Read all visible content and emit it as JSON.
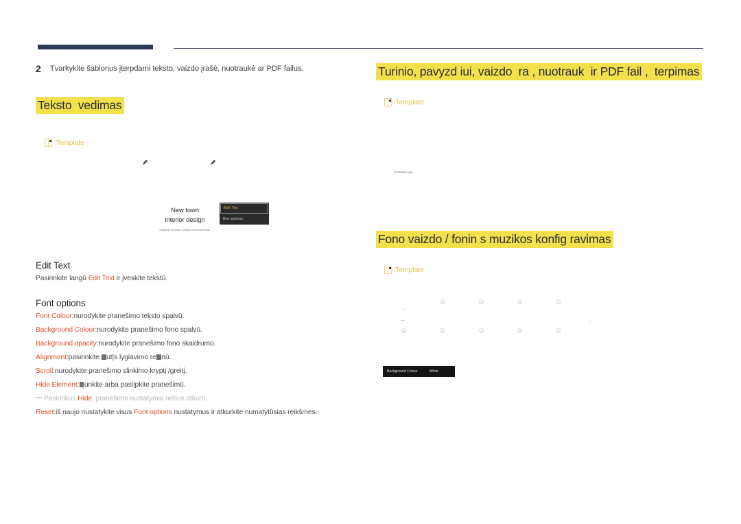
{
  "page": {
    "step_number": "2",
    "step_text": "Tvarkykite šablonus įterpdami teksto, vaizdo įrašė, nuotraukė ar PDF failus."
  },
  "left": {
    "heading": "Teksto  vedimas",
    "template_badge": "Template",
    "mock": {
      "card_title_line1": "New town",
      "card_title_line2": "interior design",
      "card_subtitle": "Exquisite evolution unfolds tomorrow design",
      "menu_items": [
        {
          "label": "Edit Tex",
          "active": true
        },
        {
          "label": "Bnt options",
          "active": false
        }
      ]
    },
    "sections": [
      {
        "heading": "Edit Text",
        "lines": [
          {
            "parts": [
              {
                "t": "Pasirinkite langū ",
                "style": "plain"
              },
              {
                "t": "Edit Text",
                "style": "kw"
              },
              {
                "t": " ir įveskite tekstū.",
                "style": "plain"
              }
            ]
          }
        ]
      },
      {
        "heading": "Font options",
        "lines": [
          {
            "parts": [
              {
                "t": "Font Colour",
                "style": "kw"
              },
              {
                "t": ":nurodykite pranešimo teksto spalvū.",
                "style": "plain"
              }
            ]
          },
          {
            "parts": [
              {
                "t": "Background Colour",
                "style": "kw"
              },
              {
                "t": ":nurodykite pranešimo fono spalvū.",
                "style": "plain"
              }
            ]
          },
          {
            "parts": [
              {
                "t": "Background opacity",
                "style": "kw"
              },
              {
                "t": ":nurodykite pranešimo fono skaidrumū.",
                "style": "plain"
              }
            ]
          },
          {
            "parts": [
              {
                "t": "Alignment",
                "style": "kw"
              },
              {
                "t": ":pasirinkite ",
                "style": "plain"
              },
              {
                "t": "",
                "style": "missing"
              },
              {
                "t": "ut|s lygiavimo re",
                "style": "plain"
              },
              {
                "t": "",
                "style": "missing"
              },
              {
                "t": "nū.",
                "style": "plain"
              }
            ]
          },
          {
            "parts": [
              {
                "t": "Scroll",
                "style": "kw"
              },
              {
                "t": ":nurodykite pranešimo slinkimo kryptį /greitį.",
                "style": "plain"
              }
            ]
          },
          {
            "parts": [
              {
                "t": "Hide Element",
                "style": "kw"
              },
              {
                "t": ":",
                "style": "plain"
              },
              {
                "t": "",
                "style": "missing"
              },
              {
                "t": "unkite arba pasl|pkite pranešimū.",
                "style": "plain"
              }
            ]
          },
          {
            "parts": [
              {
                "t": "",
                "style": "dash"
              },
              {
                "t": "Pasirinkus ",
                "style": "muted"
              },
              {
                "t": "Hide",
                "style": "kw"
              },
              {
                "t": ", pranešimo nustatymai nebus atkurti.",
                "style": "muted"
              }
            ]
          },
          {
            "parts": [
              {
                "t": "Reset",
                "style": "kw"
              },
              {
                "t": ":iš naujo nustatykite visus ",
                "style": "plain"
              },
              {
                "t": "Font options",
                "style": "kw"
              },
              {
                "t": " nustatymus ir atkurkite numatytūsias reikšmes.",
                "style": "plain"
              }
            ]
          }
        ]
      }
    ]
  },
  "right": {
    "heading_1": "Turinio, pavyzd iui, vaizdo  ra , nuotrauk  ir PDF fail ,  terpimas",
    "template_badge_1": "Template",
    "picture_label": "picture1.jpg",
    "heading_2": "Fono vaizdo / fonin s muzikos konfig ravimas",
    "template_badge_2": "Template",
    "settings_bar": {
      "label": "Background Colour",
      "value": "White"
    }
  },
  "colors": {
    "highlight": "#f2e14c",
    "accent_orange": "#e8502b",
    "template_gold": "#f0c14b",
    "navy": "#2e3a58"
  }
}
